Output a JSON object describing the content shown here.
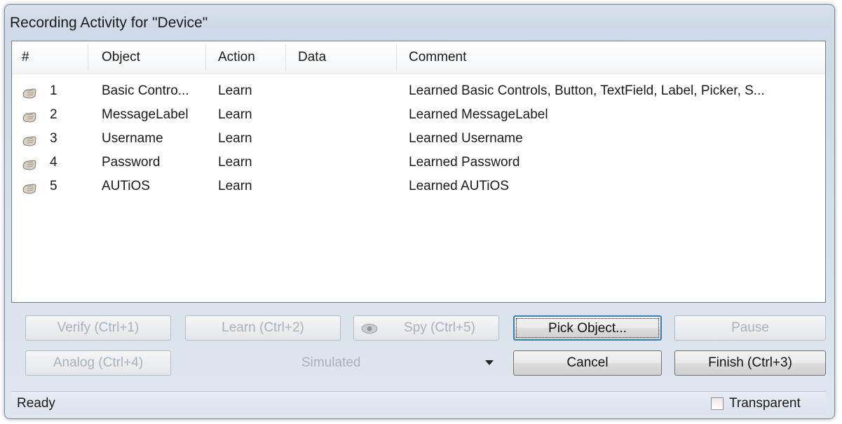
{
  "window": {
    "title": "Recording Activity for \"Device\""
  },
  "table": {
    "columns": [
      "#",
      "Object",
      "Action",
      "Data",
      "Comment"
    ],
    "rows": [
      {
        "num": "1",
        "object": "Basic Contro...",
        "action": "Learn",
        "data": "",
        "comment": "Learned Basic Controls, Button, TextField, Label, Picker, S..."
      },
      {
        "num": "2",
        "object": "MessageLabel",
        "action": "Learn",
        "data": "",
        "comment": "Learned MessageLabel"
      },
      {
        "num": "3",
        "object": "Username",
        "action": "Learn",
        "data": "",
        "comment": "Learned Username"
      },
      {
        "num": "4",
        "object": "Password",
        "action": "Learn",
        "data": "",
        "comment": "Learned Password"
      },
      {
        "num": "5",
        "object": "AUTiOS",
        "action": "Learn",
        "data": "",
        "comment": "Learned AUTiOS"
      }
    ]
  },
  "buttons": {
    "verify": "Verify (Ctrl+1)",
    "learn": "Learn (Ctrl+2)",
    "spy": "Spy (Ctrl+5)",
    "pick": "Pick Object...",
    "pause": "Pause",
    "analog": "Analog (Ctrl+4)",
    "cancel": "Cancel",
    "finish": "Finish (Ctrl+3)"
  },
  "combo": {
    "value": "Simulated"
  },
  "status": {
    "text": "Ready",
    "transparent_label": "Transparent",
    "transparent_checked": false
  },
  "icons": {
    "row_icon": "learn-hand-icon",
    "spy_icon": "eye-icon",
    "combo_arrow": "dropdown-arrow-icon"
  }
}
